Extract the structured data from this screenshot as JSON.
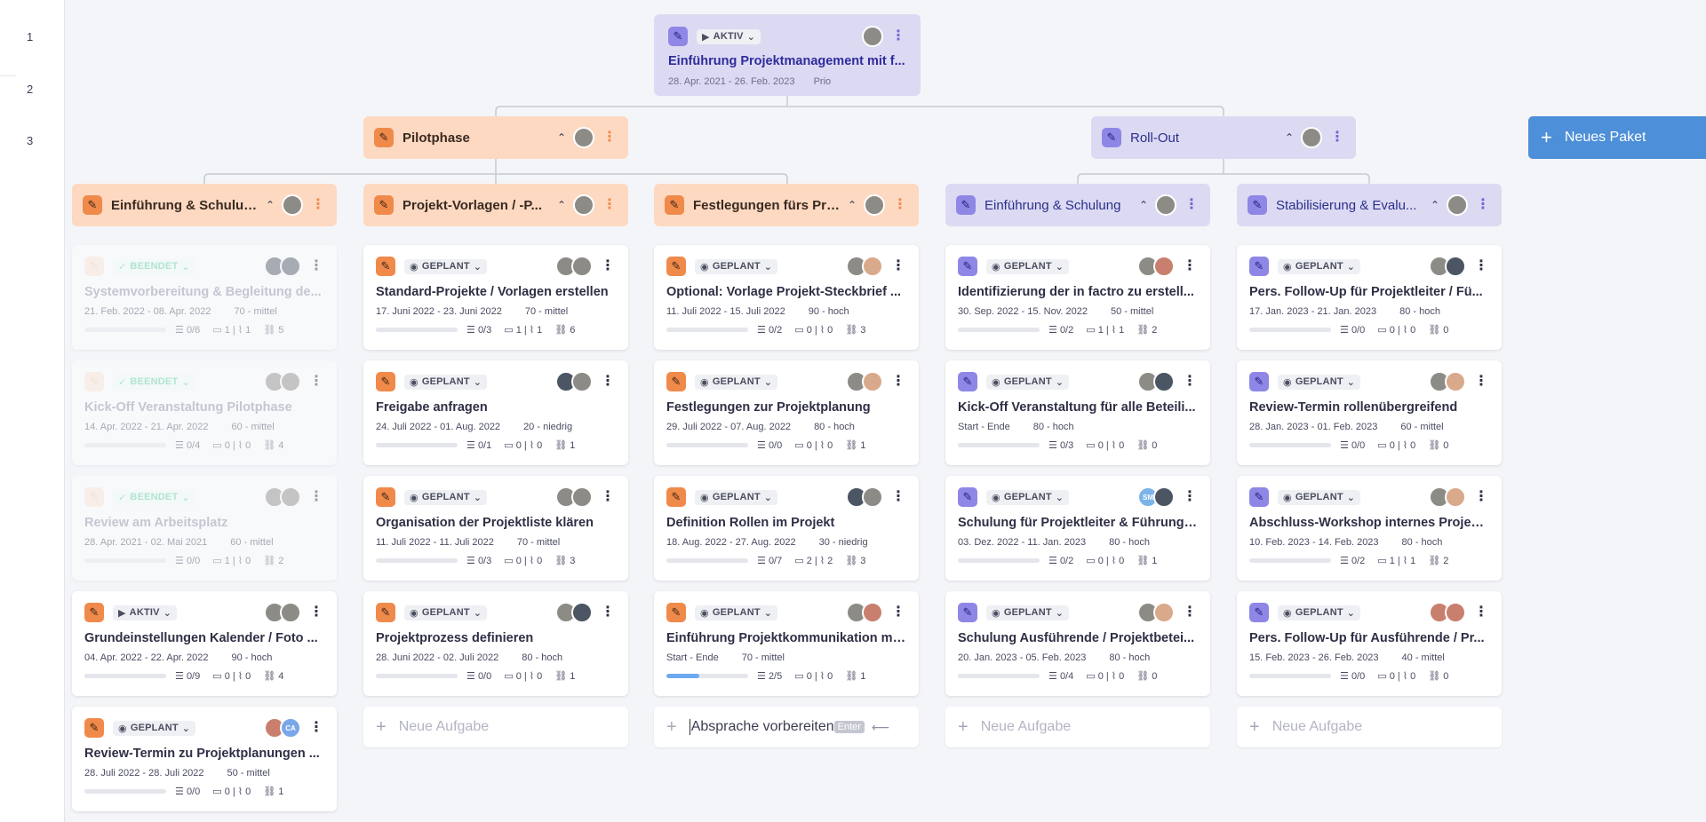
{
  "row_numbers": [
    "1",
    "2",
    "3"
  ],
  "root": {
    "status": "AKTIV",
    "title": "Einführung Projektmanagement mit f...",
    "dates": "28. Apr. 2021 - 26. Feb. 2023",
    "prio": "Prio"
  },
  "packages": [
    {
      "title": "Pilotphase",
      "color": "orange"
    },
    {
      "title": "Roll-Out",
      "color": "purple"
    }
  ],
  "new_package_label": "Neues Paket",
  "columns": [
    {
      "title": "Einführung & Schulun...",
      "color": "orange",
      "tasks": [
        {
          "status": "BEENDET",
          "title": "Systemvorbereitung & Begleitung de...",
          "dates": "21. Feb. 2022 - 08. Apr. 2022",
          "prio": "70 - mittel",
          "subtasks": "0/6",
          "comments": "1",
          "attachments": "1",
          "links": "5",
          "progress": 0
        },
        {
          "status": "BEENDET",
          "title": "Kick-Off Veranstaltung Pilotphase",
          "dates": "14. Apr. 2022 - 21. Apr. 2022",
          "prio": "60 - mittel",
          "subtasks": "0/4",
          "comments": "0",
          "attachments": "0",
          "links": "4",
          "progress": 0
        },
        {
          "status": "BEENDET",
          "title": "Review am Arbeitsplatz",
          "dates": "28. Apr. 2021 - 02. Mai 2021",
          "prio": "60 - mittel",
          "subtasks": "0/0",
          "comments": "1",
          "attachments": "0",
          "links": "2",
          "progress": 0
        },
        {
          "status": "AKTIV",
          "title": "Grundeinstellungen Kalender / Foto ...",
          "dates": "04. Apr. 2022 - 22. Apr. 2022",
          "prio": "90 - hoch",
          "subtasks": "0/9",
          "comments": "0",
          "attachments": "0",
          "links": "4",
          "progress": 0
        },
        {
          "status": "GEPLANT",
          "title": "Review-Termin zu Projektplanungen ...",
          "dates": "28. Juli 2022 - 28. Juli 2022",
          "prio": "50 - mittel",
          "subtasks": "0/0",
          "comments": "0",
          "attachments": "0",
          "links": "1",
          "progress": 0
        }
      ],
      "new_task": null
    },
    {
      "title": "Projekt-Vorlagen / -P...",
      "color": "orange",
      "tasks": [
        {
          "status": "GEPLANT",
          "title": "Standard-Projekte / Vorlagen erstellen",
          "dates": "17. Juni 2022 - 23. Juni 2022",
          "prio": "70 - mittel",
          "subtasks": "0/3",
          "comments": "1",
          "attachments": "1",
          "links": "6",
          "progress": 0
        },
        {
          "status": "GEPLANT",
          "title": "Freigabe anfragen",
          "dates": "24. Juli 2022 - 01. Aug. 2022",
          "prio": "20 - niedrig",
          "subtasks": "0/1",
          "comments": "0",
          "attachments": "0",
          "links": "1",
          "progress": 0
        },
        {
          "status": "GEPLANT",
          "title": "Organisation der Projektliste klären",
          "dates": "11. Juli 2022 - 11. Juli 2022",
          "prio": "70 - mittel",
          "subtasks": "0/3",
          "comments": "0",
          "attachments": "0",
          "links": "3",
          "progress": 0
        },
        {
          "status": "GEPLANT",
          "title": "Projektprozess definieren",
          "dates": "28. Juni 2022 - 02. Juli 2022",
          "prio": "80 - hoch",
          "subtasks": "0/0",
          "comments": "0",
          "attachments": "0",
          "links": "1",
          "progress": 0
        }
      ],
      "new_task": "Neue Aufgabe"
    },
    {
      "title": "Festlegungen fürs Pro...",
      "color": "orange",
      "tasks": [
        {
          "status": "GEPLANT",
          "title": "Optional: Vorlage Projekt-Steckbrief ...",
          "dates": "11. Juli 2022 - 15. Juli 2022",
          "prio": "90 - hoch",
          "subtasks": "0/2",
          "comments": "0",
          "attachments": "0",
          "links": "3",
          "progress": 0
        },
        {
          "status": "GEPLANT",
          "title": "Festlegungen zur Projektplanung",
          "dates": "29. Juli 2022 - 07. Aug. 2022",
          "prio": "80 - hoch",
          "subtasks": "0/0",
          "comments": "0",
          "attachments": "0",
          "links": "1",
          "progress": 0
        },
        {
          "status": "GEPLANT",
          "title": "Definition Rollen im Projekt",
          "dates": "18. Aug. 2022 - 27. Aug. 2022",
          "prio": "30 - niedrig",
          "subtasks": "0/7",
          "comments": "2",
          "attachments": "2",
          "links": "3",
          "progress": 0
        },
        {
          "status": "GEPLANT",
          "title": "Einführung Projektkommunikation mi...",
          "dates": "Start - Ende",
          "prio": "70 - mittel",
          "subtasks": "2/5",
          "comments": "0",
          "attachments": "0",
          "links": "1",
          "progress": 0.4
        }
      ],
      "new_task": "Absprache vorbereiten",
      "new_task_enter": "Enter",
      "new_task_back": "⟵"
    },
    {
      "title": "Einführung & Schulung",
      "color": "purple",
      "tasks": [
        {
          "status": "GEPLANT",
          "title": "Identifizierung der in factro zu erstell...",
          "dates": "30. Sep. 2022 - 15. Nov. 2022",
          "prio": "50 - mittel",
          "subtasks": "0/2",
          "comments": "1",
          "attachments": "1",
          "links": "2",
          "progress": 0
        },
        {
          "status": "GEPLANT",
          "title": "Kick-Off Veranstaltung für alle Beteili...",
          "dates": "Start - Ende",
          "prio": "80 - hoch",
          "subtasks": "0/3",
          "comments": "0",
          "attachments": "0",
          "links": "0",
          "progress": 0
        },
        {
          "status": "GEPLANT",
          "title": "Schulung für Projektleiter & Führungs...",
          "dates": "03. Dez. 2022 - 11. Jan. 2023",
          "prio": "80 - hoch",
          "subtasks": "0/2",
          "comments": "0",
          "attachments": "0",
          "links": "1",
          "progress": 0,
          "avatar_initials": "SM"
        },
        {
          "status": "GEPLANT",
          "title": "Schulung Ausführende / Projektbetei...",
          "dates": "20. Jan. 2023 - 05. Feb. 2023",
          "prio": "80 - hoch",
          "subtasks": "0/4",
          "comments": "0",
          "attachments": "0",
          "links": "0",
          "progress": 0
        }
      ],
      "new_task": "Neue Aufgabe"
    },
    {
      "title": "Stabilisierung & Evalu...",
      "color": "purple",
      "tasks": [
        {
          "status": "GEPLANT",
          "title": "Pers. Follow-Up für Projektleiter / Fü...",
          "dates": "17. Jan. 2023 - 21. Jan. 2023",
          "prio": "80 - hoch",
          "subtasks": "0/0",
          "comments": "0",
          "attachments": "0",
          "links": "0",
          "progress": 0
        },
        {
          "status": "GEPLANT",
          "title": "Review-Termin rollenübergreifend",
          "dates": "28. Jan. 2023 - 01. Feb. 2023",
          "prio": "60 - mittel",
          "subtasks": "0/0",
          "comments": "0",
          "attachments": "0",
          "links": "0",
          "progress": 0
        },
        {
          "status": "GEPLANT",
          "title": "Abschluss-Workshop internes Projekt...",
          "dates": "10. Feb. 2023 - 14. Feb. 2023",
          "prio": "80 - hoch",
          "subtasks": "0/2",
          "comments": "1",
          "attachments": "1",
          "links": "2",
          "progress": 0
        },
        {
          "status": "GEPLANT",
          "title": "Pers. Follow-Up für Ausführende / Pr...",
          "dates": "15. Feb. 2023 - 26. Feb. 2023",
          "prio": "40 - mittel",
          "subtasks": "0/0",
          "comments": "0",
          "attachments": "0",
          "links": "0",
          "progress": 0
        }
      ],
      "new_task": "Neue Aufgabe"
    }
  ],
  "review_card_initials": "CA",
  "icons": {
    "edit": "pencil-icon",
    "menu": "kebab-icon",
    "collapse": "chevron-up-icon",
    "status_dropdown": "chevron-down-icon",
    "play": "play-icon",
    "check": "check-icon",
    "subtasks": "checklist-icon",
    "comments": "comment-icon",
    "attachments": "paperclip-icon",
    "links": "link-icon",
    "add": "plus-icon"
  },
  "colors": {
    "orange_bg": "#fdd9c2",
    "orange_accent": "#f08a4b",
    "purple_bg": "#dcdaf3",
    "purple_accent": "#8f87e6",
    "done_status": "#5fd3a3",
    "new_package_button": "#4d8fd8"
  }
}
